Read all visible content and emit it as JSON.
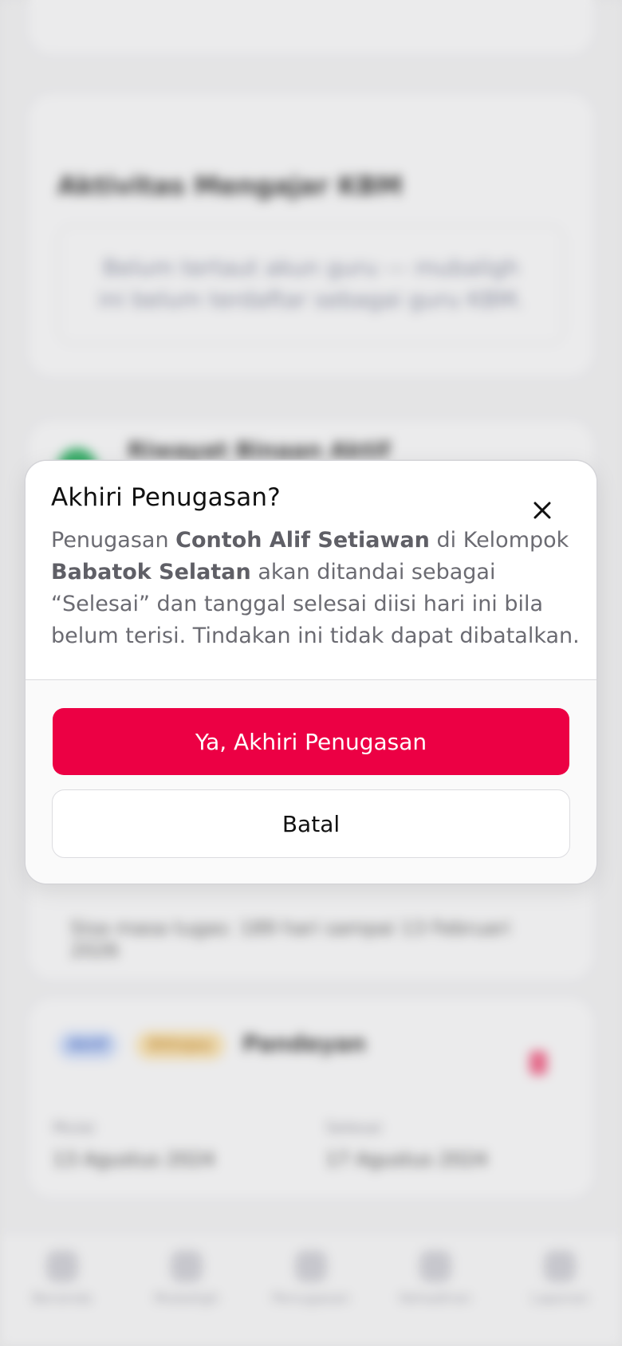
{
  "background": {
    "section_title": "Aktivitas Mengajar KBM",
    "empty_note": "Belum tertaut akun guru — mubaligh ini belum terdaftar sebagai guru KBM.",
    "card_heading": "Riwayat Binaan Aktif",
    "duration_note": "Sisa masa tugas: 189 hari sampai 13 Februari 2026",
    "assignment": {
      "type_badge": "Aktif",
      "status_badge": "Ditinjau",
      "location": "Pandeyan",
      "start_label": "Mulai",
      "start_value": "13 Agustus 2024",
      "end_label": "Selesai",
      "end_value": "17 Agustus 2024"
    },
    "nav": [
      "Beranda",
      "Mubaligh",
      "Penugasan",
      "Kehadiran",
      "Laporan"
    ]
  },
  "dialog": {
    "title": "Akhiri Penugasan?",
    "body_prefix": "Penugasan ",
    "person": "Contoh Alif Setiawan",
    "body_mid": " di Kelompok ",
    "group": "Babatok Selatan",
    "body_suffix": " akan ditandai sebagai “Selesai” dan tanggal selesai diisi hari ini bila belum terisi. Tindakan ini tidak dapat dibatalkan.",
    "confirm_label": "Ya, Akhiri Penugasan",
    "cancel_label": "Batal",
    "close_icon": "close-icon"
  },
  "colors": {
    "danger": "#ec0044"
  }
}
